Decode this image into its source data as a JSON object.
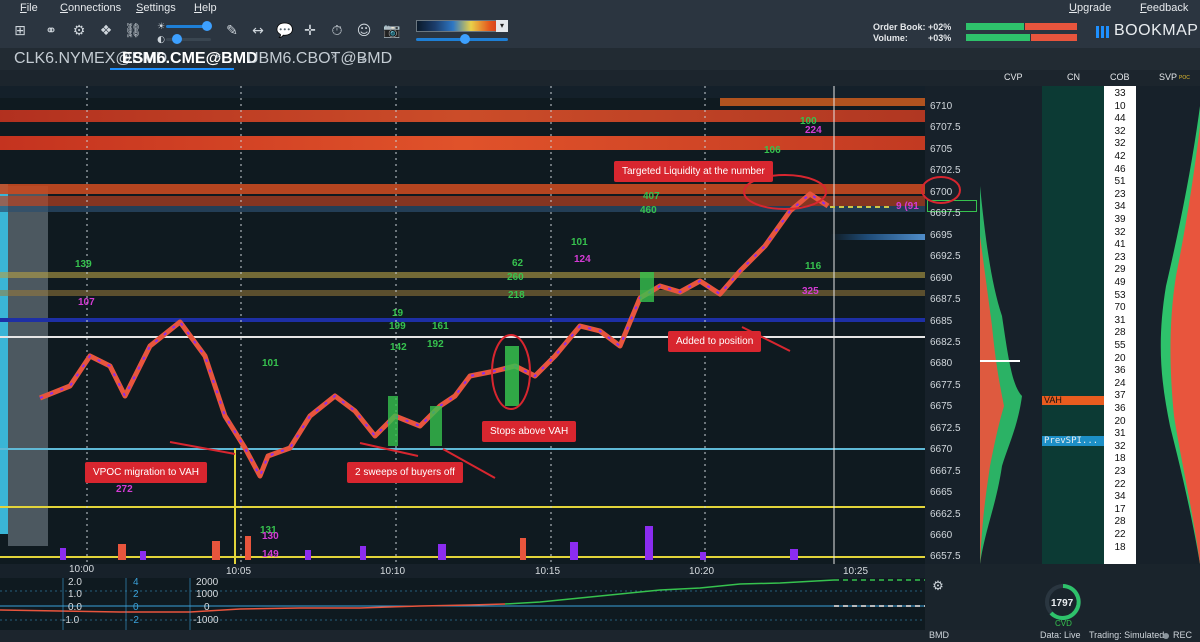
{
  "menu": [
    "File",
    "Connections",
    "Settings",
    "Help"
  ],
  "upgrade": "Upgrade",
  "feedback": "Feedback",
  "order_book_label": "Order Book:",
  "order_book_value": "+02%",
  "volume_label": "Volume:",
  "volume_value": "+03%",
  "brand": "BOOKMAP",
  "tabs": [
    {
      "label": "CLK6.NYMEX@BMD",
      "active": false
    },
    {
      "label": "ESM6.CME@BMD",
      "active": true
    },
    {
      "label": "UBM6.CBOT@BMD",
      "active": false
    }
  ],
  "add_tab": "+",
  "close_glyph": "×",
  "columns": {
    "cvp": "CVP",
    "cn": "CN",
    "cob": "COB",
    "svp": "SVP"
  },
  "poc_label": "POC",
  "prices": [
    "6710",
    "6707.5",
    "6705",
    "6702.5",
    "6700",
    "6697.5",
    "6695",
    "6692.5",
    "6690",
    "6687.5",
    "6685",
    "6682.5",
    "6680",
    "6677.5",
    "6675",
    "6672.5",
    "6670",
    "6667.5",
    "6665",
    "6662.5",
    "6660",
    "6657.5"
  ],
  "time_labels": [
    "10:00",
    "10:05",
    "10:10",
    "10:15",
    "10:20",
    "10:25"
  ],
  "annotations": {
    "vpoc": "VPOC migration to VAH",
    "sweeps": "2 sweeps of buyers off",
    "stops": "Stops above VAH",
    "added": "Added to position",
    "targeted": "Targeted Liquidity at the number"
  },
  "cn_labels": {
    "vah": "VAH",
    "prev": "PrevSPI..."
  },
  "cob_values": [
    "33",
    "10",
    "44",
    "32",
    "32",
    "42",
    "46",
    "51",
    "23",
    "34",
    "39",
    "32",
    "41",
    "23",
    "29",
    "49",
    "53",
    "70",
    "31",
    "28",
    "55",
    "20",
    "36",
    "24",
    "37",
    "36",
    "20",
    "31",
    "32",
    "18",
    "23",
    "22",
    "34",
    "17",
    "28",
    "22",
    "18"
  ],
  "current_price_marker": "9 (91",
  "vol_labels": {
    "v139": "139",
    "v107": "107",
    "v101a": "101",
    "v131": "131",
    "v130": "130",
    "v149": "149",
    "v272": "272",
    "v19": "19",
    "v199": "199",
    "v142": "142",
    "v161": "161",
    "v192": "192",
    "v62": "62",
    "v260": "260",
    "v218": "218",
    "v101b": "101",
    "v124": "124",
    "v407": "407",
    "v460": "460",
    "v106": "106",
    "v100": "100",
    "v224": "224",
    "v116": "116",
    "v325": "325"
  },
  "bottom_axis_left": [
    "2.0",
    "1.0",
    "0.0",
    "-1.0"
  ],
  "bottom_axis_mid": [
    "4",
    "2",
    "0",
    "-2"
  ],
  "bottom_axis_right": [
    "2000",
    "1000",
    "0",
    "-1000"
  ],
  "cvd_value": "1797",
  "cvd_label": "CVD",
  "status": {
    "provider": "BMD",
    "data": "Data: Live",
    "trading": "Trading: Simulated",
    "rec": "REC"
  },
  "colors": {
    "accent": "#1e90ff",
    "bid": "#2ec26b",
    "ask": "#e8553d",
    "annot": "#d8262f",
    "vah": "#e85c1f",
    "prev": "#1d8fc6"
  }
}
